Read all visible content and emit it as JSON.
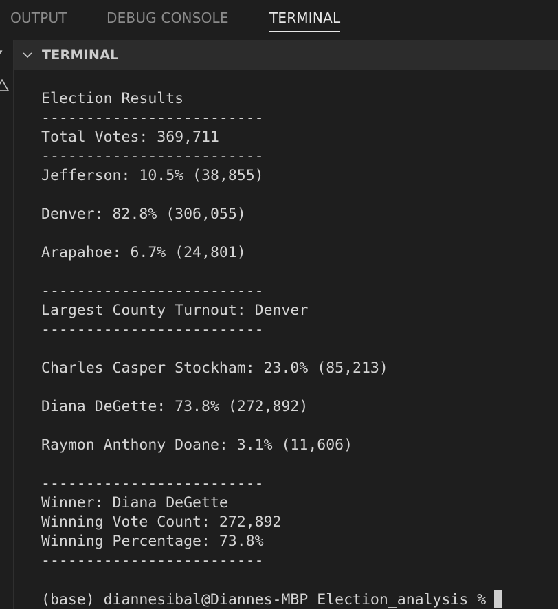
{
  "panel": {
    "tabs": [
      {
        "label": "OUTPUT"
      },
      {
        "label": "DEBUG CONSOLE"
      },
      {
        "label": "TERMINAL"
      }
    ],
    "active_tab": "TERMINAL",
    "section_title": "TERMINAL"
  },
  "terminal": {
    "lines": [
      "Election Results",
      "-------------------------",
      "Total Votes: 369,711",
      "-------------------------",
      "Jefferson: 10.5% (38,855)",
      "",
      "Denver: 82.8% (306,055)",
      "",
      "Arapahoe: 6.7% (24,801)",
      "",
      "-------------------------",
      "Largest County Turnout: Denver",
      "-------------------------",
      "",
      "Charles Casper Stockham: 23.0% (85,213)",
      "",
      "Diana DeGette: 73.8% (272,892)",
      "",
      "Raymon Anthony Doane: 3.1% (11,606)",
      "",
      "-------------------------",
      "Winner: Diana DeGette",
      "Winning Vote Count: 272,892",
      "Winning Percentage: 73.8%",
      "-------------------------"
    ],
    "prompt": "(base) diannesibal@Diannes-MBP Election_analysis %"
  },
  "colors": {
    "background": "#1e1e1e",
    "header_background": "#2c2c2c",
    "text": "#d4d4d4",
    "inactive_tab": "#8b8b8b",
    "active_tab": "#e7e7e7"
  },
  "icons": {
    "collapse": "chevron-down-icon",
    "warning": "warning-icon"
  }
}
